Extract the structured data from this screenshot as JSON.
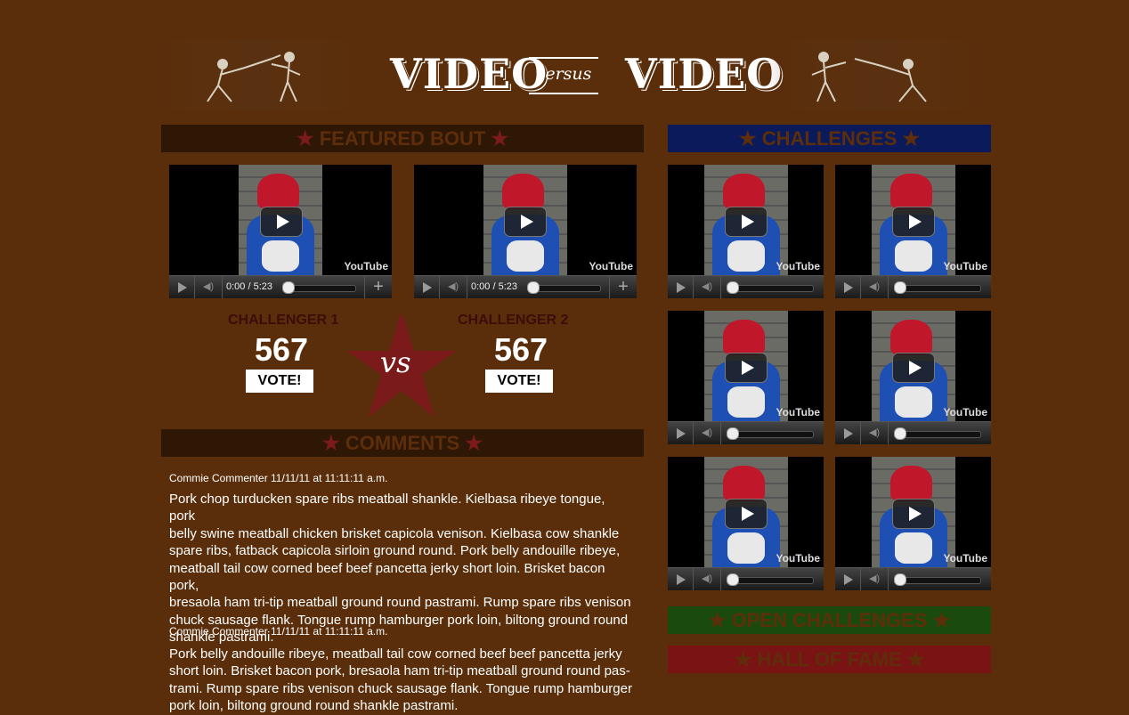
{
  "header": {
    "logo_left": "VIDEO",
    "logo_versus": "versus",
    "logo_right": "VIDEO"
  },
  "featured": {
    "title": "FEATURED BOUT",
    "videos": [
      {
        "time": "0:00 / 5:23"
      },
      {
        "time": "0:00 / 5:23"
      }
    ],
    "challenger1": {
      "label": "CHALLENGER 1",
      "score": "567",
      "vote": "VOTE!"
    },
    "challenger2": {
      "label": "CHALLENGER 2",
      "score": "567",
      "vote": "VOTE!"
    },
    "vs": "vs"
  },
  "comments": {
    "title": "COMMENTS",
    "items": [
      {
        "meta": "Commie Commenter 11/11/11 at 11:11:11 a.m.",
        "lines": [
          "Pork chop turducken spare ribs meatball shankle. Kielbasa ribeye tongue, pork",
          "belly swine meatball chicken brisket capicola venison. Kielbasa cow shankle",
          "spare ribs, fatback capicola sirloin ground round. Pork belly andouille ribeye,",
          "meatball tail cow corned beef beef pancetta jerky short loin. Brisket bacon pork,",
          "bresaola ham tri-tip meatball ground round pastrami. Rump spare ribs venison",
          "chuck sausage flank. Tongue rump hamburger pork loin, biltong ground round",
          "shankle pastrami."
        ]
      },
      {
        "meta": "Commie Commenter 11/11/11 at 11:11:11 a.m.",
        "lines": [
          "Pork belly andouille ribeye, meatball tail cow corned beef beef pancetta jerky",
          "short loin. Brisket bacon pork, bresaola ham tri-tip meatball ground round pas-",
          "trami. Rump spare ribs venison chuck sausage flank. Tongue rump hamburger",
          "pork loin, biltong ground round shankle pastrami."
        ]
      }
    ]
  },
  "sidebar": {
    "challenges_title": "CHALLENGES",
    "open_title": "OPEN CHALLENGES",
    "hall_title": "HALL OF FAME"
  },
  "youtube_label": "YouTube",
  "star_glyph": "★",
  "colors": {
    "background": "#5a2e0b",
    "featured_bar": "#2f1706",
    "challenges_bar": "#0a1a5a",
    "open_bar": "#1a4a0e",
    "hall_bar": "#7a1414",
    "star_red": "#7a1a1a"
  }
}
